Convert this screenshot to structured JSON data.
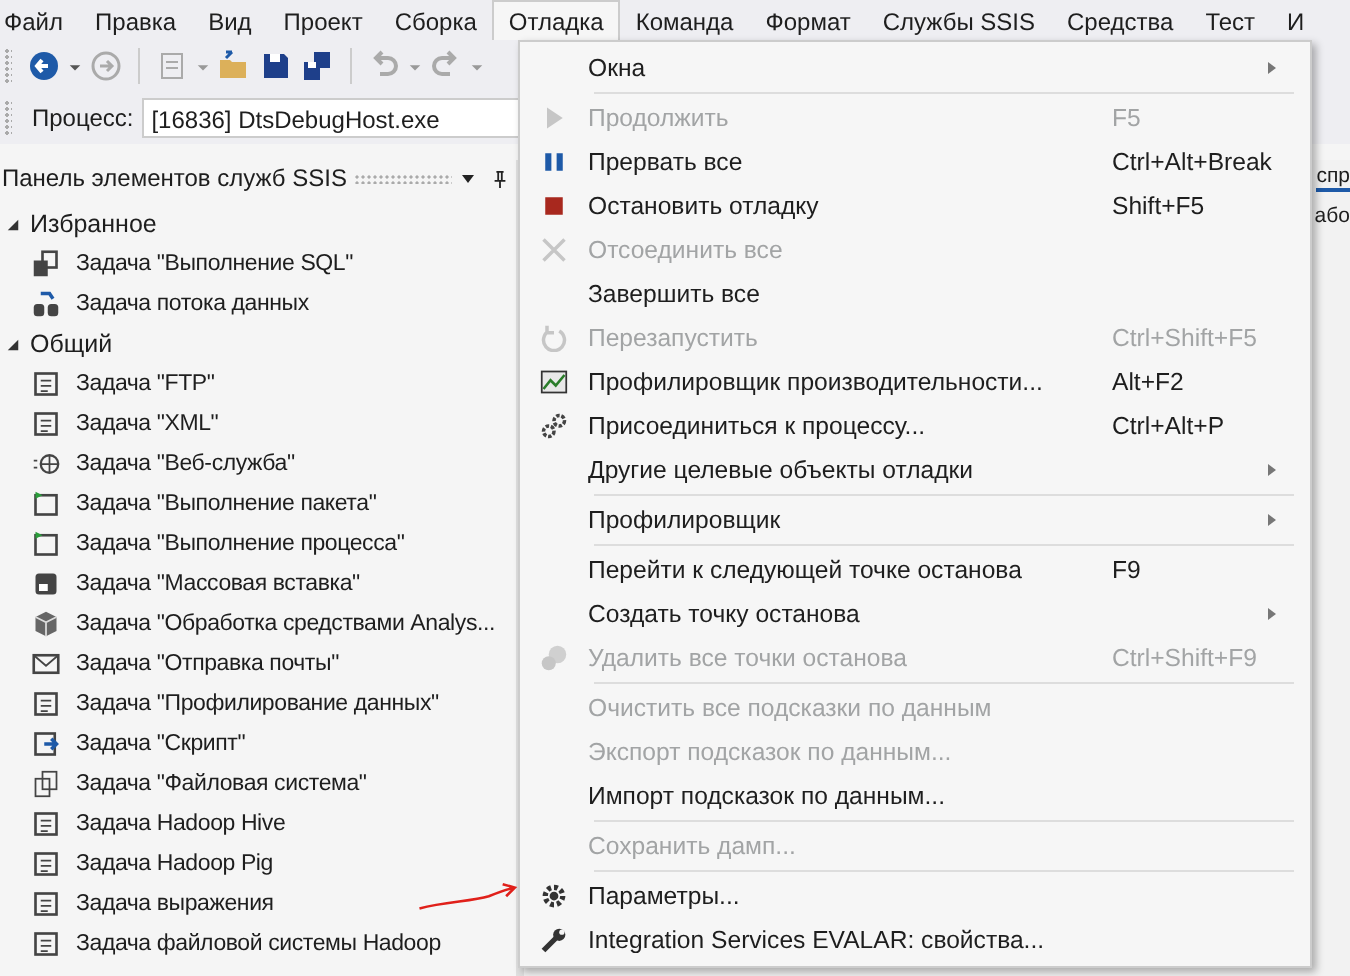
{
  "menubar": [
    {
      "label": "Файл",
      "selected": false
    },
    {
      "label": "Правка",
      "selected": false
    },
    {
      "label": "Вид",
      "selected": false
    },
    {
      "label": "Проект",
      "selected": false
    },
    {
      "label": "Сборка",
      "selected": false
    },
    {
      "label": "Отладка",
      "selected": true
    },
    {
      "label": "Команда",
      "selected": false
    },
    {
      "label": "Формат",
      "selected": false
    },
    {
      "label": "Службы SSIS",
      "selected": false
    },
    {
      "label": "Средства",
      "selected": false
    },
    {
      "label": "Тест",
      "selected": false
    },
    {
      "label": "И",
      "selected": false
    }
  ],
  "process": {
    "label": "Процесс:",
    "value": "[16836] DtsDebugHost.exe"
  },
  "toolbox": {
    "title": "Панель элементов служб SSIS",
    "groups": [
      {
        "label": "Избранное",
        "expanded": true,
        "children": [
          {
            "label": "Задача \"Выполнение SQL\""
          },
          {
            "label": "Задача потока данных"
          }
        ]
      },
      {
        "label": "Общий",
        "expanded": true,
        "children": [
          {
            "label": "Задача \"FTP\""
          },
          {
            "label": "Задача \"XML\""
          },
          {
            "label": "Задача \"Веб-служба\""
          },
          {
            "label": "Задача \"Выполнение пакета\""
          },
          {
            "label": "Задача \"Выполнение процесса\""
          },
          {
            "label": "Задача \"Массовая вставка\""
          },
          {
            "label": "Задача \"Обработка средствами Analys..."
          },
          {
            "label": "Задача \"Отправка почты\""
          },
          {
            "label": "Задача \"Профилирование данных\""
          },
          {
            "label": "Задача \"Скрипт\""
          },
          {
            "label": "Задача \"Файловая система\""
          },
          {
            "label": "Задача Hadoop Hive"
          },
          {
            "label": "Задача Hadoop Pig"
          },
          {
            "label": "Задача выражения"
          },
          {
            "label": "Задача файловой системы Hadoop"
          }
        ]
      }
    ]
  },
  "right_pane": {
    "tab": "спр",
    "text": "або"
  },
  "debug_menu": {
    "groups": [
      [
        {
          "label": "Окна",
          "submenu": true,
          "disabled": false
        }
      ],
      [
        {
          "label": "Продолжить",
          "shortcut": "F5",
          "disabled": true
        },
        {
          "label": "Прервать все",
          "shortcut": "Ctrl+Alt+Break",
          "disabled": false
        },
        {
          "label": "Остановить отладку",
          "shortcut": "Shift+F5",
          "disabled": false
        },
        {
          "label": "Отсоединить все",
          "disabled": true
        },
        {
          "label": "Завершить все",
          "disabled": false
        },
        {
          "label": "Перезапустить",
          "shortcut": "Ctrl+Shift+F5",
          "disabled": true
        },
        {
          "label": "Профилировщик производительности...",
          "shortcut": "Alt+F2",
          "disabled": false
        },
        {
          "label": "Присоединиться к процессу...",
          "shortcut": "Ctrl+Alt+P",
          "disabled": false
        },
        {
          "label": "Другие целевые объекты отладки",
          "submenu": true,
          "disabled": false
        }
      ],
      [
        {
          "label": "Профилировщик",
          "submenu": true,
          "disabled": false
        }
      ],
      [
        {
          "label": "Перейти к следующей точке останова",
          "shortcut": "F9",
          "disabled": false
        },
        {
          "label": "Создать точку останова",
          "submenu": true,
          "disabled": false
        },
        {
          "label": "Удалить все точки останова",
          "shortcut": "Ctrl+Shift+F9",
          "disabled": true
        }
      ],
      [
        {
          "label": "Очистить все подсказки по данным",
          "disabled": true
        },
        {
          "label": "Экспорт подсказок по данным...",
          "disabled": true
        },
        {
          "label": "Импорт подсказок по данным...",
          "disabled": false
        }
      ],
      [
        {
          "label": "Сохранить дамп...",
          "disabled": true
        }
      ],
      [
        {
          "label": "Параметры...",
          "disabled": false
        },
        {
          "label": "Integration Services EVALAR: свойства...",
          "disabled": false
        }
      ]
    ]
  }
}
